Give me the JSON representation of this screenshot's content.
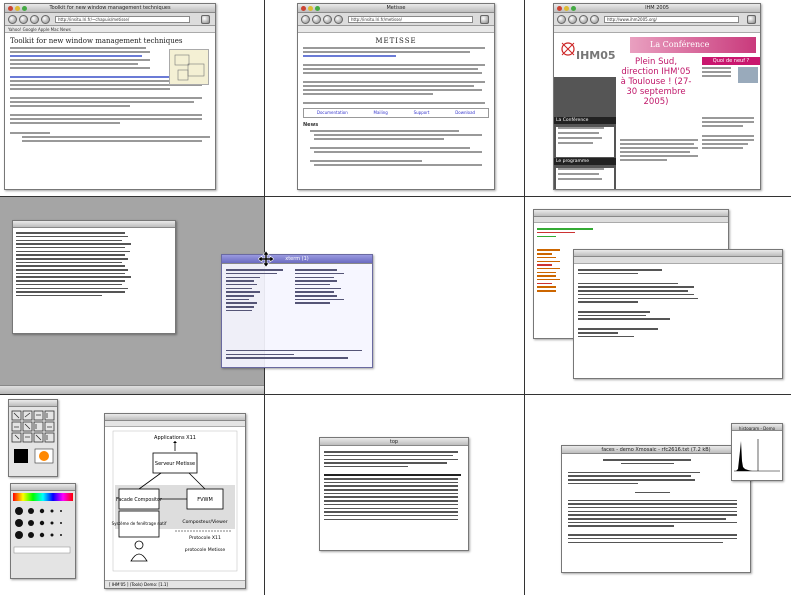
{
  "cells": {
    "c1": {
      "window_title": "Toolkit for new window management techniques",
      "url": "http://insitu.lri.fr/~chapuis/metisse/",
      "bookmarks": "Yahoo! Google Apple Mac News",
      "heading": "Toolkit for new window management techniques"
    },
    "c2": {
      "window_title": "Metisse",
      "url": "http://insitu.lri.fr/metisse/",
      "heading": "METISSE",
      "links": [
        "Documentation",
        "Mailing",
        "Support",
        "Download"
      ],
      "news_label": "News"
    },
    "c3": {
      "window_title": "IHM 2005",
      "url": "http://www.ihm2005.org/",
      "logo": "IHM05",
      "banner": "La Conférence",
      "headline": "Plein Sud, direction IHM'05 à Toulouse ! (27-30 septembre 2005)",
      "sidebar_title": "La Conférence",
      "news_title": "Quoi de neuf ?",
      "program_title": "Le programme"
    },
    "c5": {
      "window_title": "xterm (1)"
    },
    "c7": {
      "diagram_labels": {
        "x11": "Applications X11",
        "server": "Serveur Metisse",
        "fvwm": "FVWM",
        "compositor": "Composteur/Viewer",
        "facade": "Facade Compositor",
        "system": "Système de fenêtrage natif",
        "protocol": "Protocole X11",
        "user": "protocole Metisse"
      },
      "status": "[ IHM'05 ] (Tools) Demo: [1.1]"
    },
    "c8": {
      "window_title": "top"
    },
    "c9": {
      "window_title": "faces - demo Xmosaic - rfc2616.txt (7.2 kB)",
      "histogram_title": "histogram - Demo"
    }
  }
}
